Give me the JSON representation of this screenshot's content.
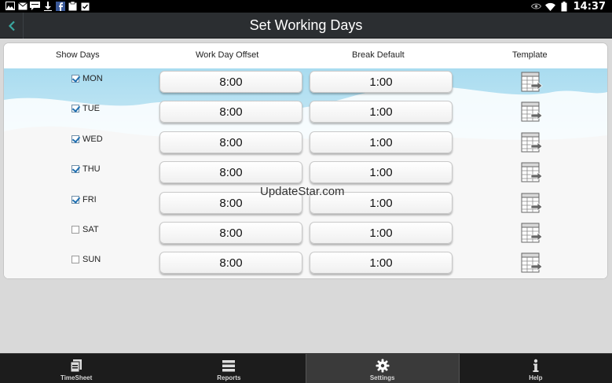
{
  "statusbar": {
    "time": "14:37",
    "notification_icons": [
      "image-icon",
      "mail-icon",
      "sms-icon",
      "download-icon",
      "facebook-icon",
      "clipboard-icon",
      "clipboard-check-icon"
    ]
  },
  "actionbar": {
    "title": "Set Working Days",
    "back_icon": "chevron-left-icon"
  },
  "columns": {
    "show_days": "Show Days",
    "work_day_offset": "Work Day Offset",
    "break_default": "Break Default",
    "template": "Template"
  },
  "rows": [
    {
      "day": "MON",
      "checked": true,
      "offset": "8:00",
      "break": "1:00"
    },
    {
      "day": "TUE",
      "checked": true,
      "offset": "8:00",
      "break": "1:00"
    },
    {
      "day": "WED",
      "checked": true,
      "offset": "8:00",
      "break": "1:00"
    },
    {
      "day": "THU",
      "checked": true,
      "offset": "8:00",
      "break": "1:00"
    },
    {
      "day": "FRI",
      "checked": true,
      "offset": "8:00",
      "break": "1:00"
    },
    {
      "day": "SAT",
      "checked": false,
      "offset": "8:00",
      "break": "1:00"
    },
    {
      "day": "SUN",
      "checked": false,
      "offset": "8:00",
      "break": "1:00"
    }
  ],
  "watermark": "UpdateStar.com",
  "tabs": [
    {
      "label": "TimeSheet",
      "icon": "timesheet-icon",
      "active": false
    },
    {
      "label": "Reports",
      "icon": "reports-icon",
      "active": false
    },
    {
      "label": "Settings",
      "icon": "gear-icon",
      "active": true
    },
    {
      "label": "Help",
      "icon": "info-icon",
      "active": false
    }
  ],
  "colors": {
    "actionbar": "#2b2e31",
    "tabbar": "#1c1c1c",
    "sky": "#a9dcf0",
    "checkbox_check": "#1f6fb0"
  }
}
